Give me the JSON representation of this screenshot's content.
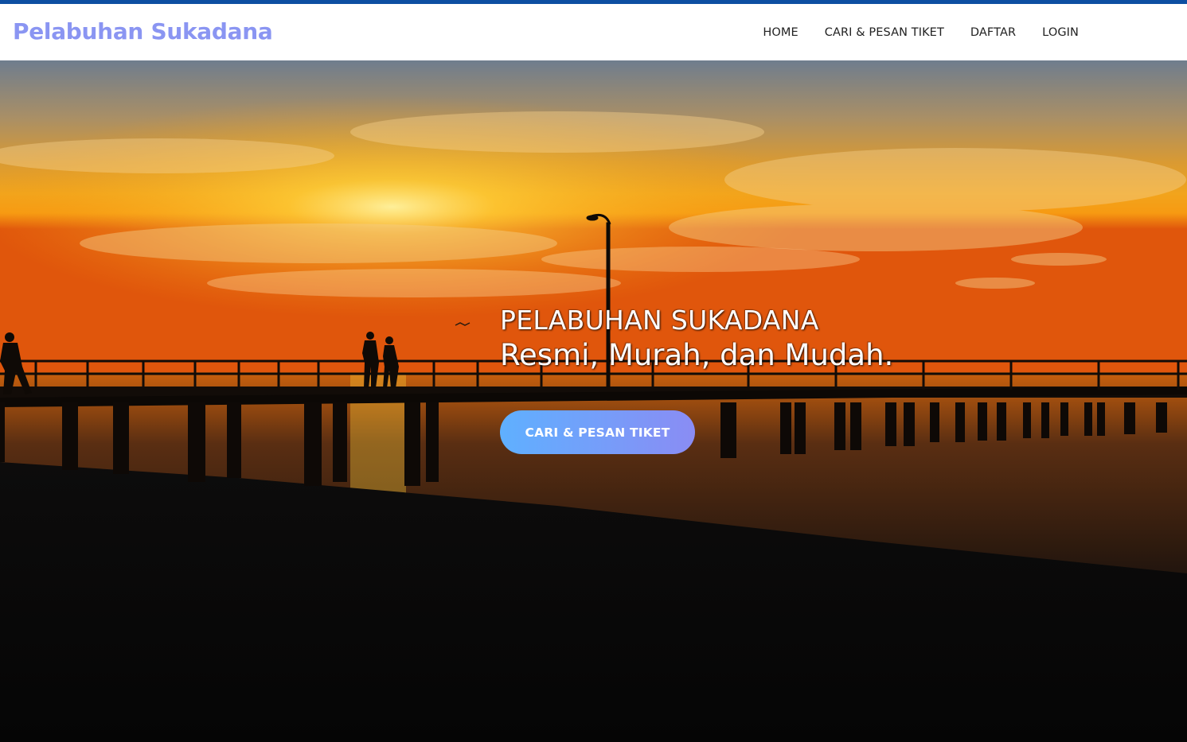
{
  "brand": {
    "name": "Pelabuhan Sukadana",
    "color": "#8a95f2"
  },
  "nav": {
    "items": [
      {
        "label": "HOME"
      },
      {
        "label": "CARI & PESAN TIKET"
      },
      {
        "label": "DAFTAR"
      },
      {
        "label": "LOGIN"
      }
    ]
  },
  "hero": {
    "title": "PELABUHAN SUKADANA",
    "subtitle": "Resmi, Murah, dan Mudah.",
    "cta_label": "CARI & PESAN TIKET",
    "background": "sunset-pier-photo"
  },
  "colors": {
    "accent_bar": "#0d4fa2",
    "cta_gradient_start": "#5fb0ff",
    "cta_gradient_end": "#8a8cf4"
  }
}
